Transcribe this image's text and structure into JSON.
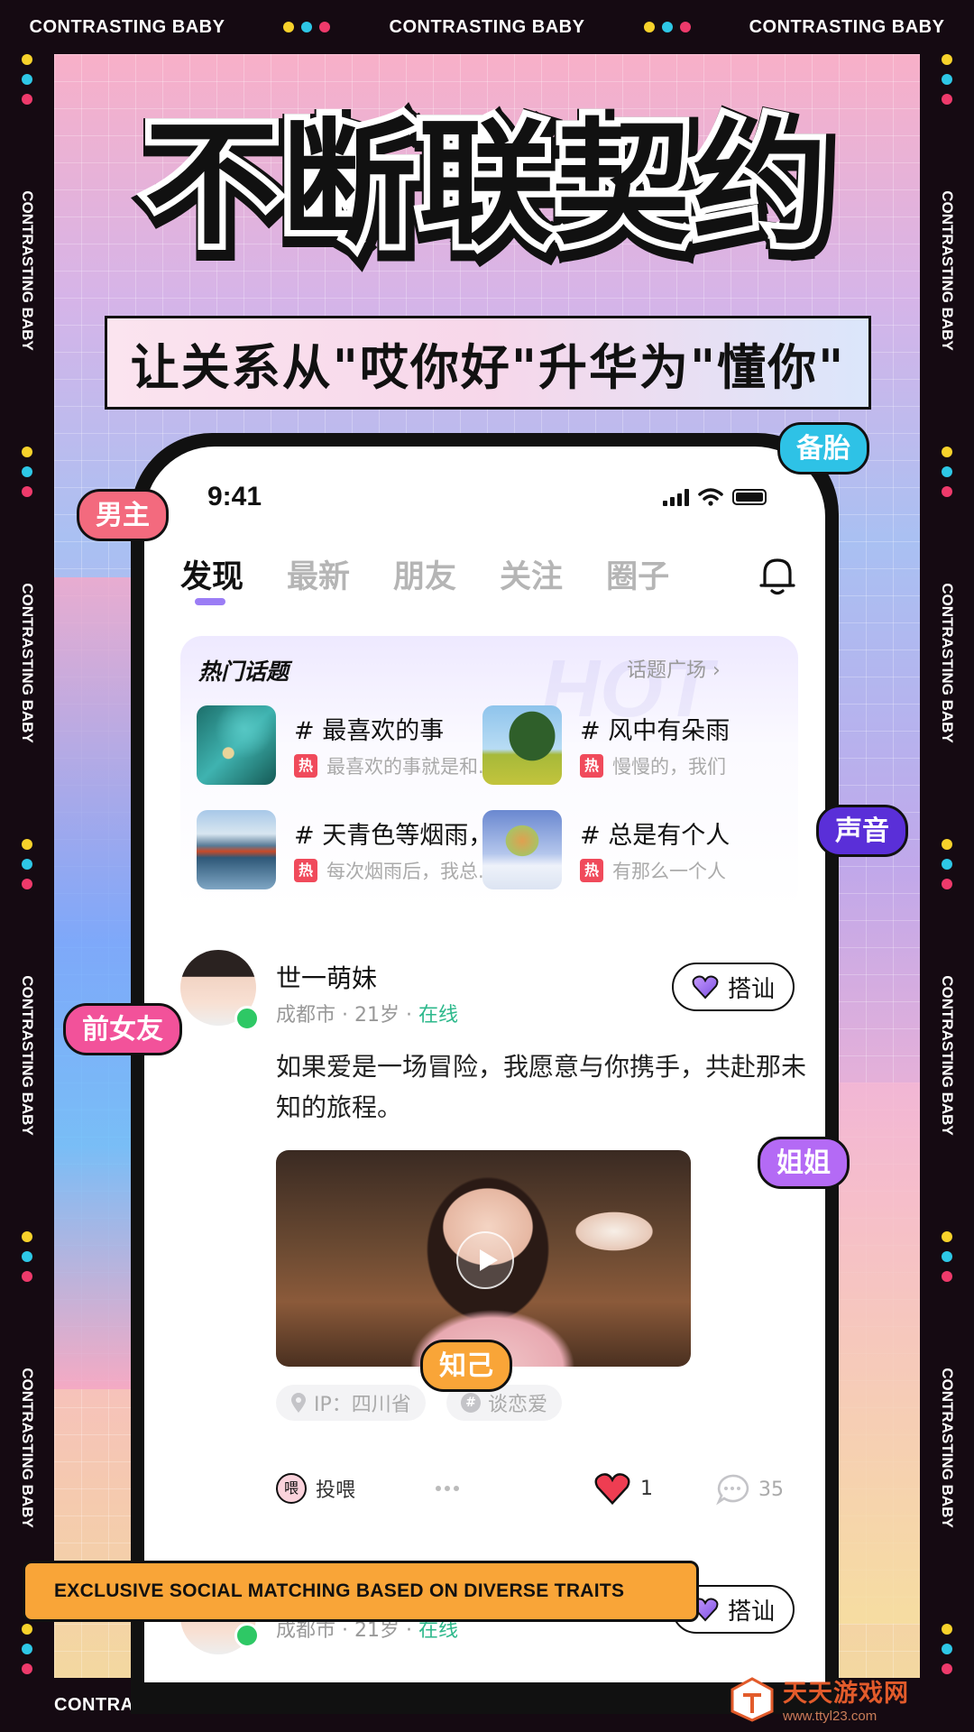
{
  "frame": {
    "strip_text": "CONTRASTING BABY",
    "dot_colors": [
      "#f7d22b",
      "#2ec7e6",
      "#ee3a6b"
    ]
  },
  "poster": {
    "headline": "不断联契约",
    "subheadline": "让关系从\"哎你好\"升华为\"懂你\"",
    "banner": "EXCLUSIVE SOCIAL MATCHING BASED ON DIVERSE TRAITS"
  },
  "float_tags": {
    "t1": "男主",
    "t2": "备胎",
    "t3": "声音",
    "t4": "前女友",
    "t5": "姐姐",
    "t6": "知己"
  },
  "status_bar": {
    "time": "9:41"
  },
  "tabs": [
    {
      "label": "发现",
      "active": true
    },
    {
      "label": "最新",
      "active": false
    },
    {
      "label": "朋友",
      "active": false
    },
    {
      "label": "关注",
      "active": false
    },
    {
      "label": "圈子",
      "active": false
    }
  ],
  "hot_topics": {
    "title": "热门话题",
    "more_label": "话题广场 ›",
    "watermark": "HOT",
    "hot_badge": "热",
    "items": [
      {
        "title": "# 最喜欢的事",
        "desc": "最喜欢的事就是和..."
      },
      {
        "title": "# 风中有朵雨",
        "desc": "慢慢的，我们"
      },
      {
        "title": "# 天青色等烟雨，...",
        "desc": "每次烟雨后，我总..."
      },
      {
        "title": "# 总是有个人",
        "desc": "有那么一个人"
      }
    ]
  },
  "posts": [
    {
      "username": "世一萌妹",
      "location": "成都市",
      "age": "21岁",
      "status": "在线",
      "greet_label": "搭讪",
      "text": "如果爱是一场冒险，我愿意与你携手，共赴那未知的旅程。",
      "ip_chip": "IP：四川省",
      "topic_chip": "谈恋爱",
      "feed_label": "投喂",
      "feed_badge": "喂",
      "like_count": "1",
      "comment_count": "35"
    },
    {
      "location": "成都市",
      "age": "21岁",
      "status": "在线",
      "greet_label": "搭讪"
    }
  ],
  "watermark": {
    "name": "天天游戏网",
    "url": "www.ttyl23.com"
  },
  "colors": {
    "accent_purple": "#9b7df5",
    "hot_red": "#f04a5b",
    "online_green": "#2cb88b",
    "banner_orange": "#f9a538"
  }
}
